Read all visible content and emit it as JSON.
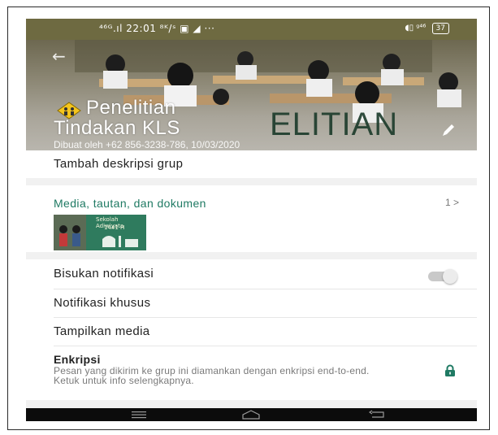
{
  "status_bar": {
    "left": "⁴⁶ᴳ.ıl 22:01 ⁸ᴷ/ˢ ▣ ◢ ···",
    "right": "◖▯ ᵍ⁴⁶",
    "battery": "37"
  },
  "header": {
    "title_line1": "Penelitian",
    "title_line2": "Tindakan KLS",
    "created_by": "Dibuat oleh +62 856-3238-786, 10/03/2020",
    "background_text": "ELITIAN"
  },
  "rows": {
    "add_description": "Tambah deskripsi grup",
    "media_title": "Media, tautan, dan dokumen",
    "media_count": "1 >",
    "thumb_text_top": "Sekolah Adiwiyata",
    "thumb_text_mid": "1441 H",
    "mute_notifications": "Bisukan notifikasi",
    "custom_notifications": "Notifikasi khusus",
    "show_media": "Tampilkan media",
    "encryption_title": "Enkripsi",
    "encryption_desc": "Pesan yang dikirim ke grup ini diamankan dengan enkripsi end-to-end. Ketuk untuk info selengkapnya."
  },
  "colors": {
    "accent": "#1f7a63",
    "status_bar": "#6e6a41",
    "nav_bar": "#0c0c0c"
  }
}
